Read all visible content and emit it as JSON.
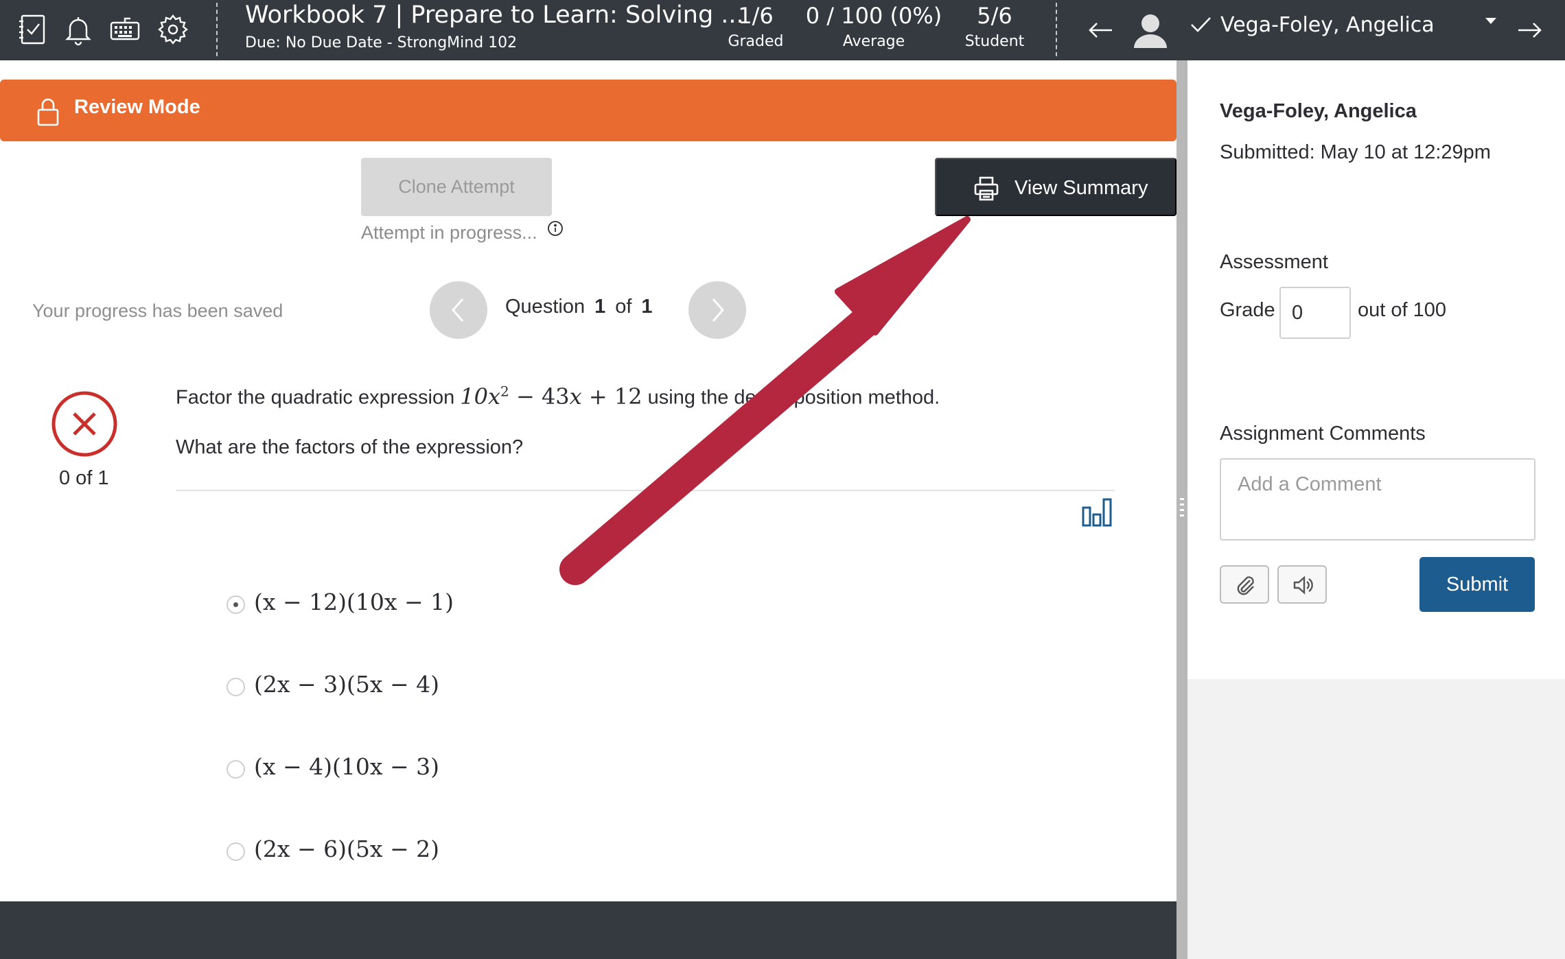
{
  "topbar": {
    "icons": [
      "gradebook-icon",
      "bell-icon",
      "keyboard-icon",
      "gear-icon"
    ],
    "title": "Workbook 7 | Prepare to Learn: Solving ...",
    "due": "Due: No Due Date - StrongMind 102",
    "stats": [
      {
        "value": "1/6",
        "label": "Graded"
      },
      {
        "value": "0 / 100 (0%)",
        "label": "Average"
      },
      {
        "value": "5/6",
        "label": "Student"
      }
    ],
    "student_name": "Vega-Foley, Angelica"
  },
  "main": {
    "banner": "Review Mode",
    "clone_button": "Clone Attempt",
    "attempt_status": "Attempt in progress...",
    "view_summary_button": "View Summary",
    "saved_text": "Your progress has been saved",
    "question_nav": {
      "label": "Question",
      "current": "1",
      "of": "of",
      "total": "1"
    },
    "score": "0 of 1",
    "question": {
      "prompt_before": "Factor the quadratic expression",
      "prompt_after": "using the decomposition method.",
      "sub": "What are the factors of the expression?"
    },
    "choices": [
      {
        "label": "(x − 12)(10x − 1)",
        "selected": true
      },
      {
        "label": "(2x − 3)(5x − 4)",
        "selected": false
      },
      {
        "label": "(x − 4)(10x − 3)",
        "selected": false
      },
      {
        "label": "(2x − 6)(5x − 2)",
        "selected": false
      }
    ]
  },
  "panel": {
    "student_name": "Vega-Foley, Angelica",
    "submitted": "Submitted: May 10 at 12:29pm",
    "assessment_heading": "Assessment",
    "grade_label": "Grade",
    "grade_value": "0",
    "out_of": "out of 100",
    "comments_heading": "Assignment Comments",
    "comment_placeholder": "Add a Comment",
    "submit_button": "Submit"
  },
  "colors": {
    "topbar": "#343a40",
    "banner": "#e96b30",
    "submit": "#1d5c8f",
    "annotation_arrow": "#b5273f",
    "incorrect": "#c9302c"
  }
}
